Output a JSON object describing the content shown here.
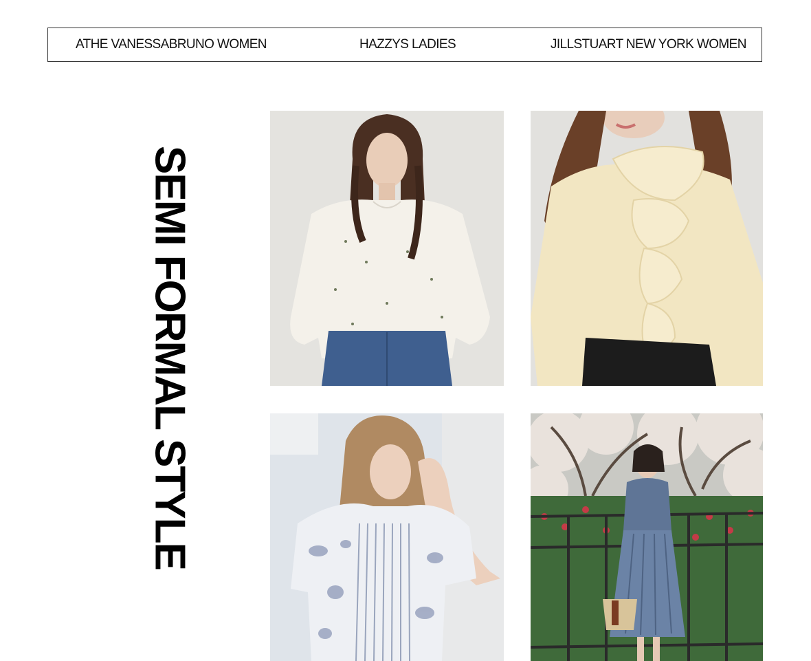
{
  "brand_nav": {
    "items": [
      {
        "label": "ATHE VANESSABRUNO WOMEN"
      },
      {
        "label": "HAZZYS LADIES"
      },
      {
        "label": "JILLSTUART NEW YORK WOMEN"
      }
    ]
  },
  "section": {
    "title": "SEMI FORMAL STYLE"
  },
  "products": [
    {
      "image": "white-floral-blouse-photo"
    },
    {
      "image": "cream-ruffle-blouse-photo"
    },
    {
      "image": "blue-print-pintuck-blouse-photo"
    },
    {
      "image": "denim-dress-outdoor-photo"
    }
  ]
}
